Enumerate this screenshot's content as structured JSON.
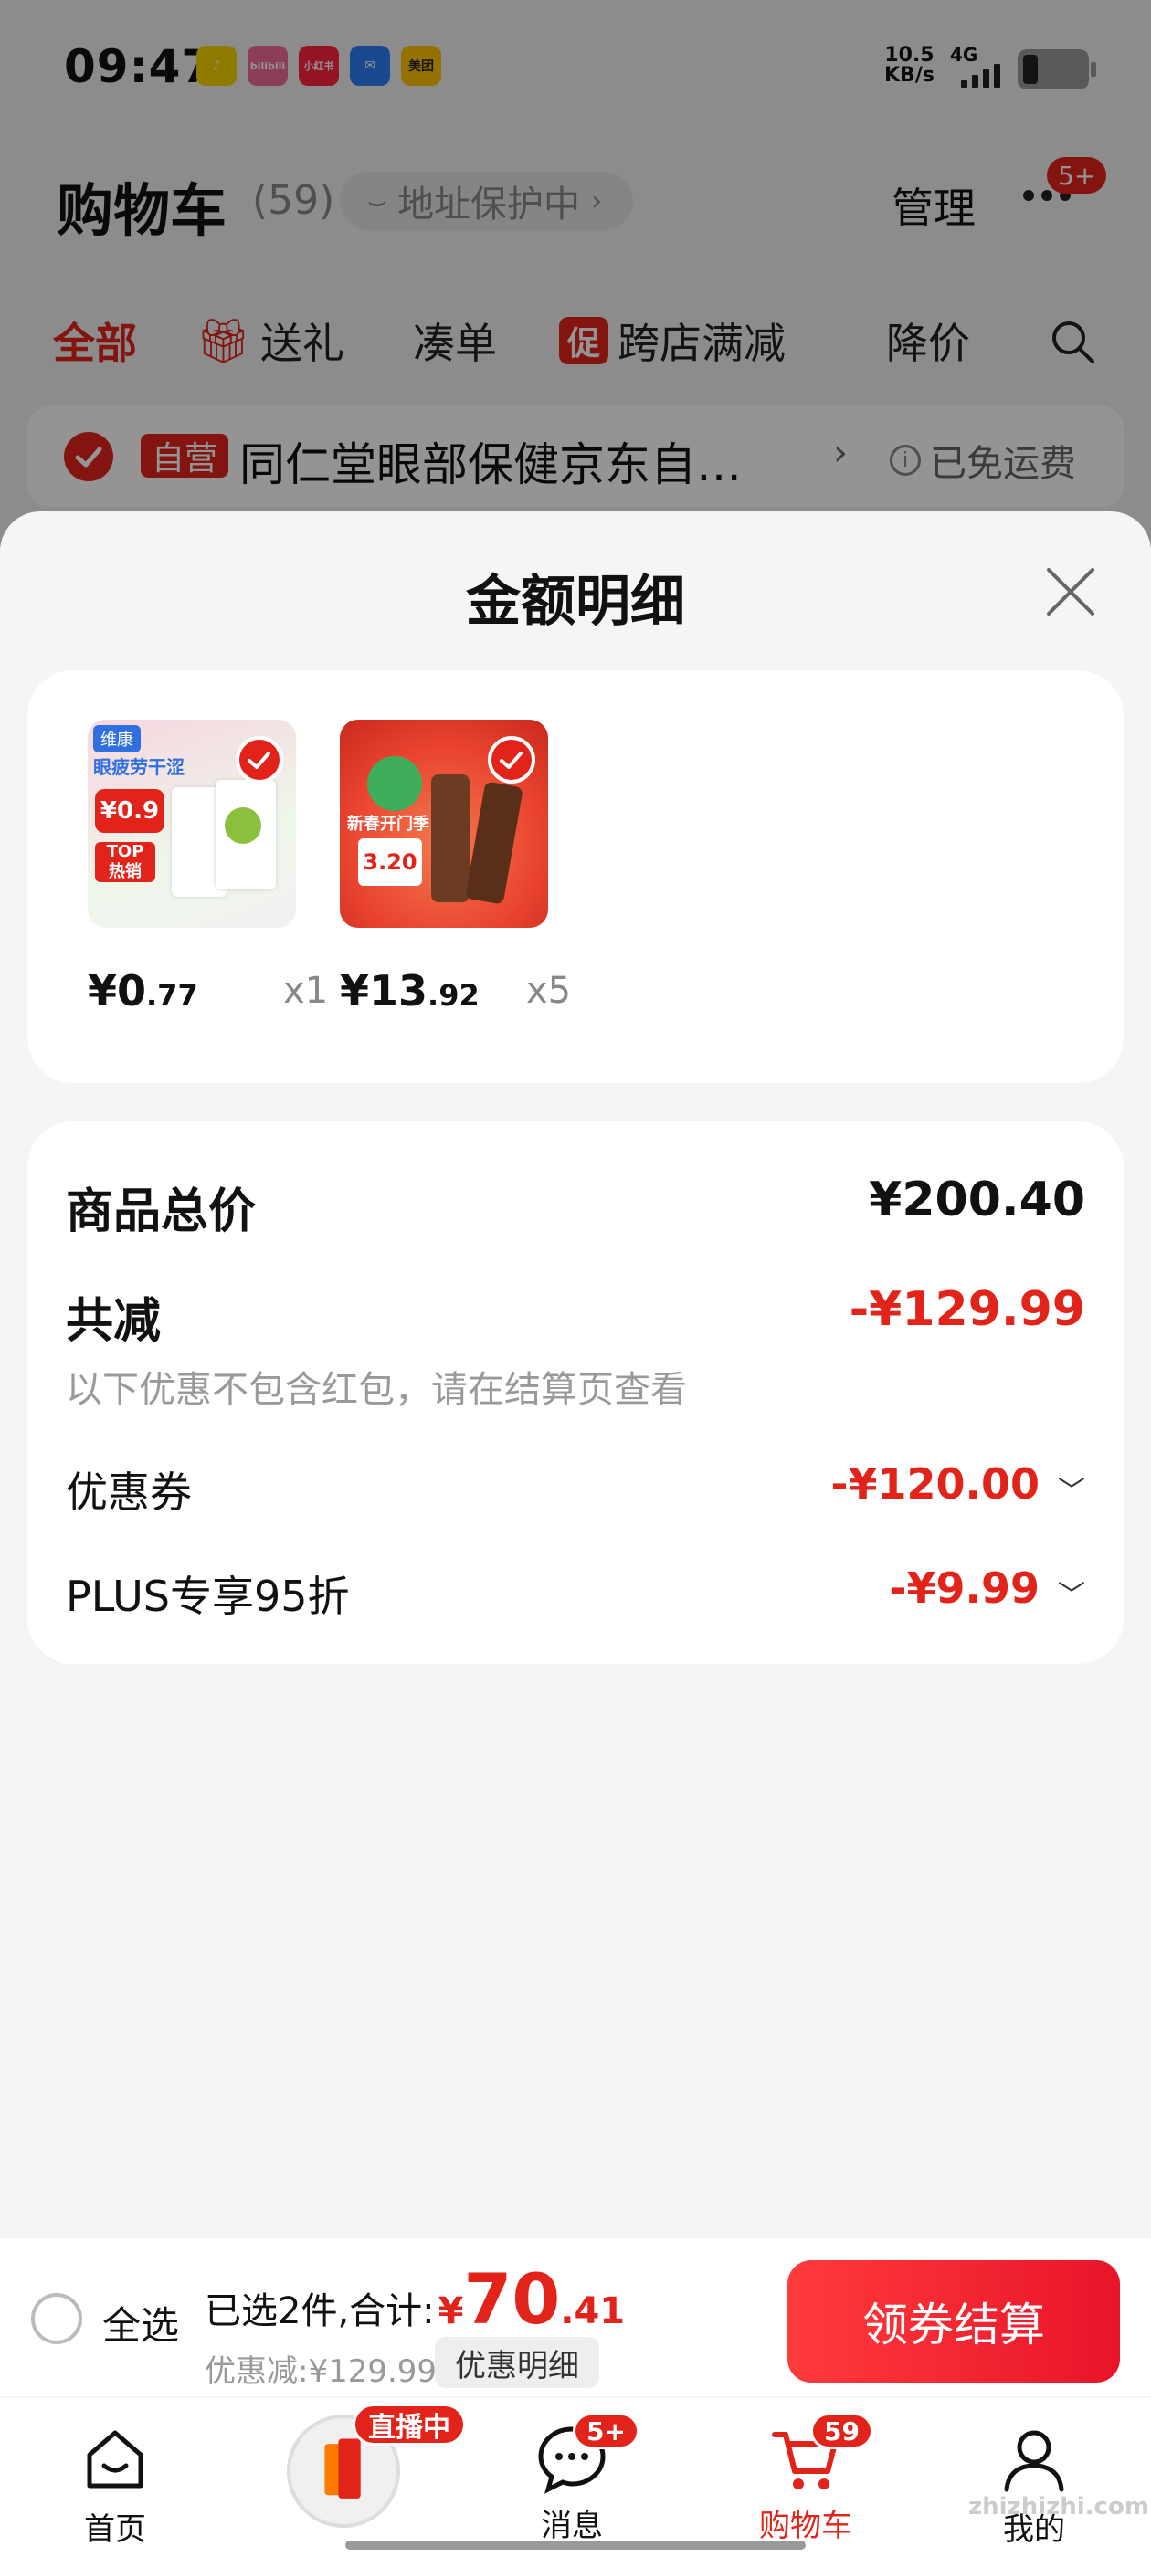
{
  "status_bar": {
    "time": "09:47",
    "apps": [
      {
        "name": "qq-music-icon",
        "label": "",
        "color": "#f5d400"
      },
      {
        "name": "bilibili-icon",
        "label": "bilibili",
        "color": "#f06a9a"
      },
      {
        "name": "xiaohongshu-icon",
        "label": "小红书",
        "color": "#ff2442"
      },
      {
        "name": "mail-icon",
        "label": "",
        "color": "#2b7cf7"
      },
      {
        "name": "meituan-icon",
        "label": "美团",
        "color": "#ffc300"
      }
    ],
    "network_speed": "10.5",
    "network_unit": "KB/s",
    "network_type": "4G"
  },
  "cart": {
    "title": "购物车",
    "count": "(59)",
    "address_protect": "地址保护中",
    "manage": "管理",
    "more_badge": "5+",
    "tabs": [
      "全部",
      "送礼",
      "凑单",
      "跨店满减",
      "降价"
    ],
    "tab_icon_promo": "促",
    "shop": {
      "tag": "自营",
      "name": "同仁堂眼部保健京东自…",
      "free_shipping": "已免运费"
    }
  },
  "sheet": {
    "title": "金额明细",
    "items": [
      {
        "price_int": "¥0",
        "price_dec": ".77",
        "qty": "x1",
        "thumb_color": "#f3d6df"
      },
      {
        "price_int": "¥13",
        "price_dec": ".92",
        "qty": "x5",
        "thumb_color": "#f04d3a"
      }
    ],
    "thumb1_text": [
      "维康",
      "眼疲劳干涩",
      "¥0.9",
      "TOP",
      "热销"
    ],
    "thumb2_text": [
      "新春开门季",
      "3.20"
    ],
    "summary": {
      "total_label": "商品总价",
      "total_value": "¥200.40",
      "reduce_label": "共减",
      "reduce_value": "-¥129.99",
      "note": "以下优惠不包含红包，请在结算页查看",
      "coupon_label": "优惠券",
      "coupon_value": "-¥120.00",
      "plus_label": "PLUS专享95折",
      "plus_value": "-¥9.99"
    }
  },
  "checkout": {
    "select_all": "全选",
    "selected_text": "已选2件,合计:",
    "yuan": "¥",
    "total_int": "70",
    "total_dec": ".41",
    "discount_text": "优惠减:¥129.99",
    "detail_button": "优惠明细",
    "checkout_button": "领券结算"
  },
  "bottom_nav": {
    "home": "首页",
    "live_badge": "直播中",
    "messages": "消息",
    "messages_badge": "5+",
    "cart": "购物车",
    "cart_badge": "59",
    "mine": "我的"
  },
  "watermark": "zhizhizhi.com",
  "colors": {
    "accent": "#e2231a"
  }
}
